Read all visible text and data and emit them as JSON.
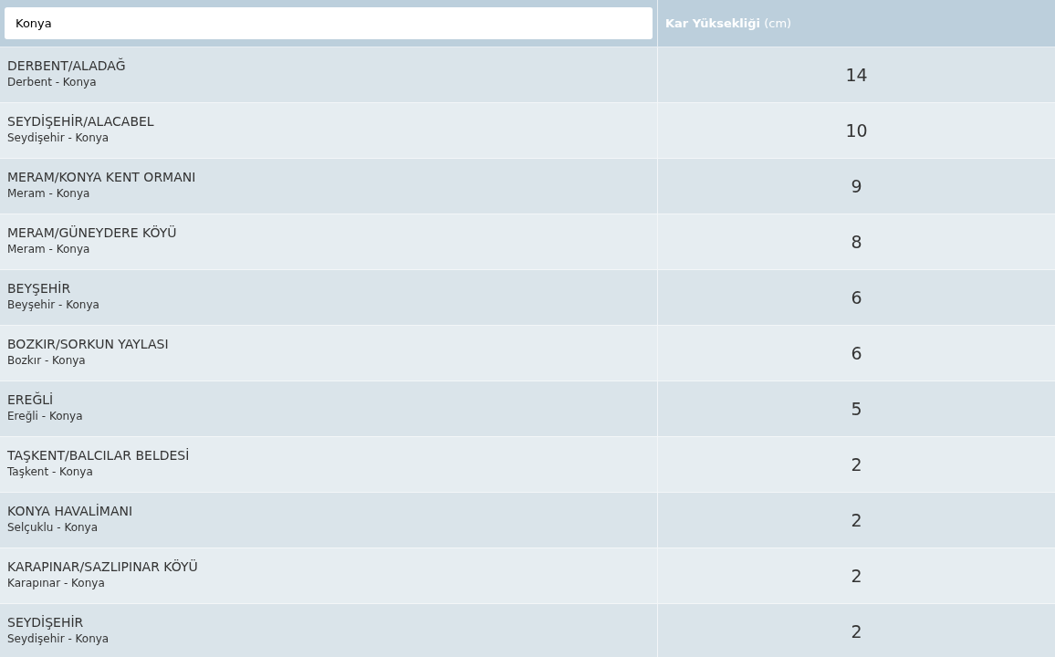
{
  "search": {
    "value": "Konya"
  },
  "header": {
    "column_2": "**Kar Yüksekliği** (cm)"
  },
  "rows": [
    {
      "station": "DERBENT/ALADAĞ",
      "location": "Derbent - Konya",
      "depth": "14"
    },
    {
      "station": "SEYDİŞEHİR/ALACABEL",
      "location": "Seydişehir - Konya",
      "depth": "10"
    },
    {
      "station": "MERAM/KONYA KENT ORMANI",
      "location": "Meram - Konya",
      "depth": "9"
    },
    {
      "station": "MERAM/GÜNEYDERE KÖYÜ",
      "location": "Meram - Konya",
      "depth": "8"
    },
    {
      "station": "BEYŞEHİR",
      "location": "Beyşehir - Konya",
      "depth": "6"
    },
    {
      "station": "BOZKIR/SORKUN YAYLASI",
      "location": "Bozkır - Konya",
      "depth": "6"
    },
    {
      "station": "EREĞLİ",
      "location": "Ereğli - Konya",
      "depth": "5"
    },
    {
      "station": "TAŞKENT/BALCILAR BELDESİ",
      "location": "Taşkent - Konya",
      "depth": "2"
    },
    {
      "station": "KONYA HAVALİMANI",
      "location": "Selçuklu - Konya",
      "depth": "2"
    },
    {
      "station": "KARAPINAR/SAZLIPINAR KÖYÜ",
      "location": "Karapınar - Konya",
      "depth": "2"
    },
    {
      "station": "SEYDİŞEHİR",
      "location": "Seydişehir - Konya",
      "depth": "2"
    }
  ]
}
